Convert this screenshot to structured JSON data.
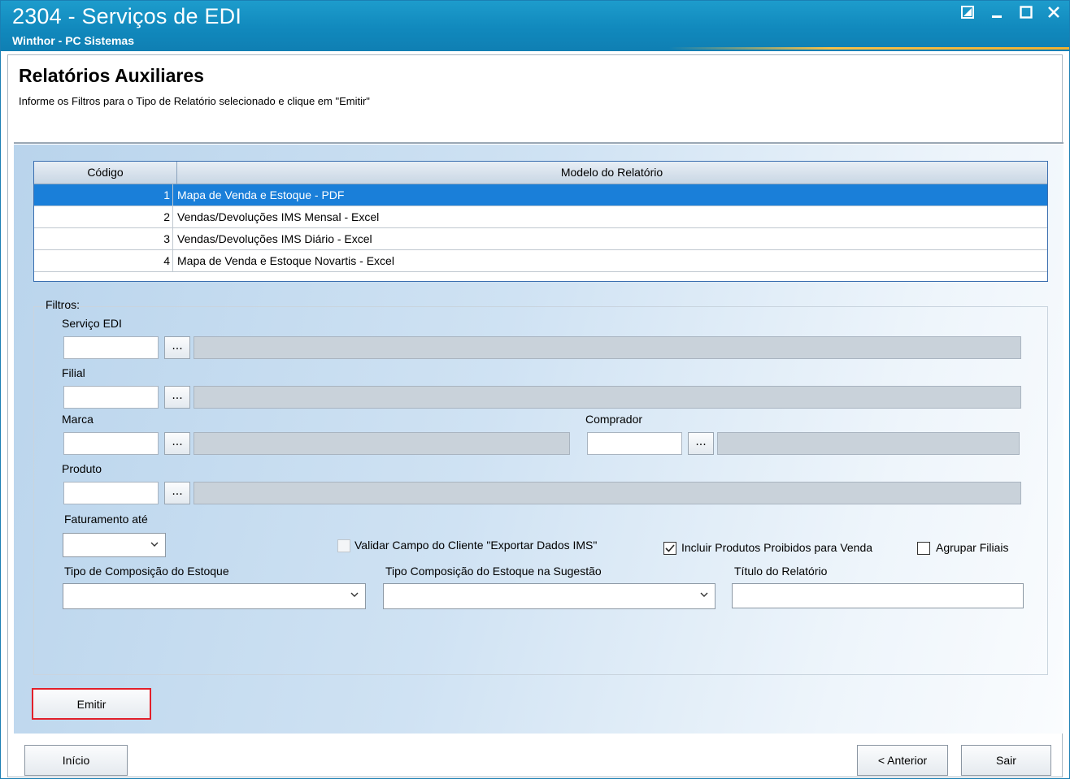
{
  "window": {
    "title": "2304 - Serviços de EDI",
    "subtitle": "Winthor - PC Sistemas"
  },
  "header": {
    "heading": "Relatórios Auxiliares",
    "hint": "Informe os Filtros para o Tipo de Relatório selecionado e clique em \"Emitir\""
  },
  "grid": {
    "columns": [
      "Código",
      "Modelo do Relatório"
    ],
    "rows": [
      {
        "codigo": "1",
        "modelo": "Mapa de Venda e Estoque - PDF",
        "selected": true
      },
      {
        "codigo": "2",
        "modelo": "Vendas/Devoluções IMS Mensal - Excel",
        "selected": false
      },
      {
        "codigo": "3",
        "modelo": "Vendas/Devoluções IMS Diário - Excel",
        "selected": false
      },
      {
        "codigo": "4",
        "modelo": "Mapa de Venda e Estoque Novartis - Excel",
        "selected": false
      }
    ],
    "selection_color": "#1a7fd9"
  },
  "filtros": {
    "group_label": "Filtros:",
    "servico_edi": {
      "label": "Serviço EDI",
      "code": "",
      "description": ""
    },
    "filial": {
      "label": "Filial",
      "code": "",
      "description": ""
    },
    "marca": {
      "label": "Marca",
      "code": "",
      "description": ""
    },
    "comprador": {
      "label": "Comprador",
      "code": "",
      "description": ""
    },
    "produto": {
      "label": "Produto",
      "code": "",
      "description": ""
    },
    "lookup_button": "...",
    "faturamento": {
      "label": "Faturamento até",
      "value": ""
    },
    "validar_campo": {
      "label": "Validar Campo do Cliente \"Exportar Dados IMS\"",
      "checked": false,
      "enabled": false
    },
    "incluir_produtos": {
      "label": "Incluir Produtos Proibidos para Venda",
      "checked": true
    },
    "agrupar_filiais": {
      "label": "Agrupar Filiais",
      "checked": false
    },
    "tipo_composicao": {
      "label": "Tipo de Composição do Estoque",
      "value": ""
    },
    "tipo_composicao_sugestao": {
      "label": "Tipo Composição do Estoque na Sugestão",
      "value": ""
    },
    "titulo_relatorio": {
      "label": "Título do Relatório",
      "value": ""
    }
  },
  "buttons": {
    "emitir": "Emitir",
    "inicio": "Início",
    "anterior": "< Anterior",
    "sair": "Sair"
  },
  "icons": [
    "restore-icon",
    "minimize-icon",
    "maximize-icon",
    "close-icon",
    "chevron-down-icon",
    "checkmark-icon"
  ],
  "colors": {
    "titlebar": "#1189bd",
    "emitir_highlight": "#e2202a"
  }
}
